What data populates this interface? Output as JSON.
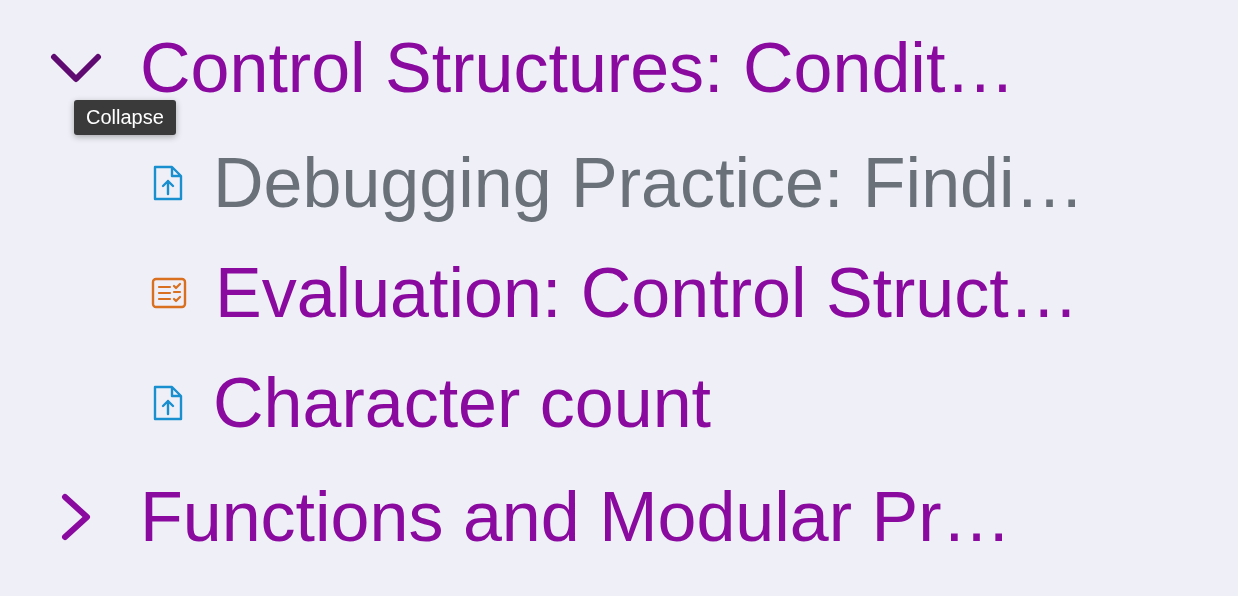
{
  "sections": [
    {
      "title": "Control Structures: Condit…",
      "expanded": true,
      "tooltip": "Collapse",
      "children": [
        {
          "title": "Debugging Practice: Findi…",
          "kind": "upload",
          "disabled": true
        },
        {
          "title": "Evaluation: Control Struct…",
          "kind": "quiz",
          "disabled": false
        },
        {
          "title": "Character count",
          "kind": "upload",
          "disabled": false
        }
      ]
    },
    {
      "title": "Functions and Modular Pr…",
      "expanded": false
    }
  ]
}
